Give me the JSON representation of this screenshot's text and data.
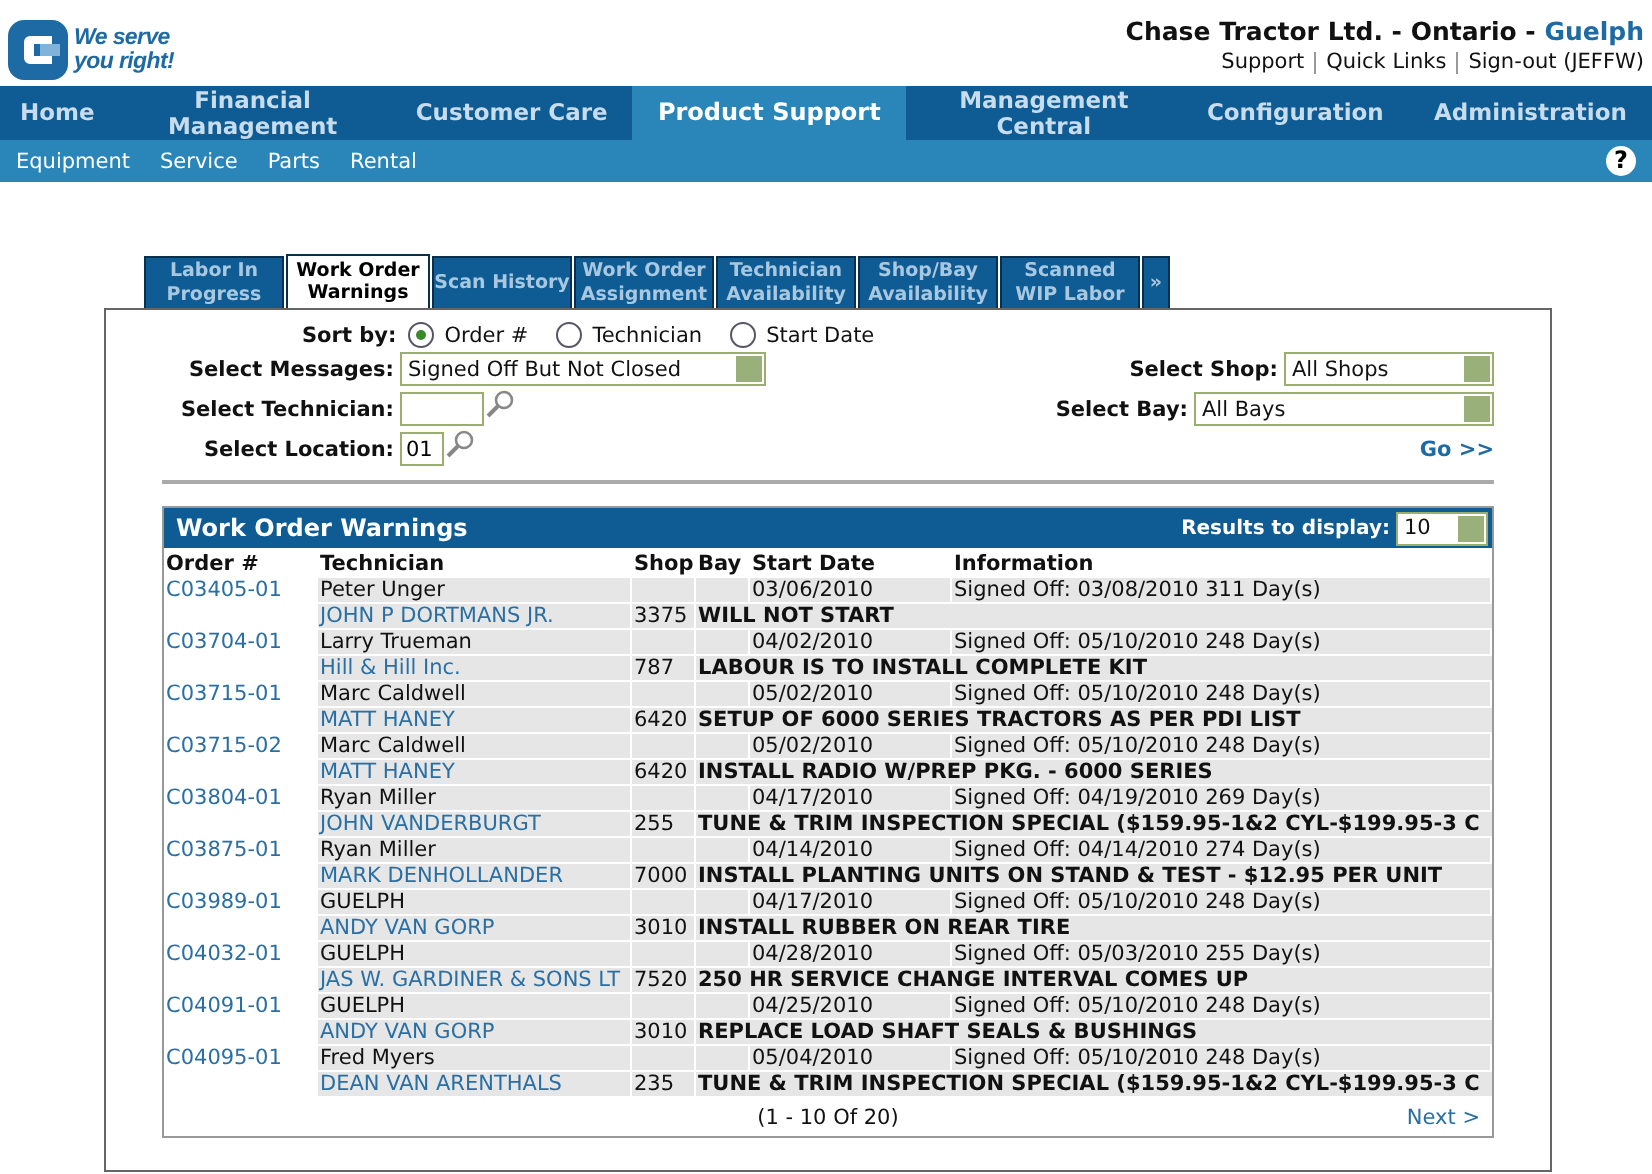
{
  "logo": {
    "tagline": "We serve you right!"
  },
  "header": {
    "company": "Chase Tractor Ltd. - Ontario - ",
    "location": "Guelph",
    "links": [
      "Support",
      "Quick Links",
      "Sign-out (JEFFW)"
    ]
  },
  "nav": [
    {
      "label": "Home",
      "selected": false
    },
    {
      "label": "Financial Management",
      "selected": false
    },
    {
      "label": "Customer Care",
      "selected": false
    },
    {
      "label": "Product Support",
      "selected": true
    },
    {
      "label": "Management Central",
      "selected": false
    },
    {
      "label": "Configuration",
      "selected": false
    },
    {
      "label": "Administration",
      "selected": false
    }
  ],
  "subnav": [
    "Equipment",
    "Service",
    "Parts",
    "Rental"
  ],
  "help_icon": "?",
  "tabs": [
    {
      "label": "Labor In Progress",
      "selected": false
    },
    {
      "label": "Work Order Warnings",
      "selected": true
    },
    {
      "label": "Scan History",
      "selected": false
    },
    {
      "label": "Work Order Assignment",
      "selected": false
    },
    {
      "label": "Technician Availability",
      "selected": false
    },
    {
      "label": "Shop/Bay Availability",
      "selected": false
    },
    {
      "label": "Scanned WIP Labor",
      "selected": false
    }
  ],
  "tabs_more": "»",
  "sort": {
    "label": "Sort by:",
    "options": [
      {
        "label": "Order #",
        "selected": true
      },
      {
        "label": "Technician",
        "selected": false
      },
      {
        "label": "Start Date",
        "selected": false
      }
    ]
  },
  "filters": {
    "messages_label": "Select Messages:",
    "messages_value": "Signed Off But Not Closed",
    "technician_label": "Select Technician:",
    "location_label": "Select Location:",
    "location_value": "01",
    "shop_label": "Select Shop:",
    "shop_value": "All Shops",
    "bay_label": "Select Bay:",
    "bay_value": "All Bays",
    "go": "Go >>"
  },
  "panel": {
    "title": "Work Order Warnings",
    "results_label": "Results to display:",
    "results_value": "10"
  },
  "table": {
    "columns": [
      "Order #",
      "Technician",
      "Shop",
      "Bay",
      "Start Date",
      "Information"
    ],
    "rows": [
      {
        "order": "C03405-01",
        "contact": "Peter Unger",
        "technician": "JOHN P DORTMANS JR.",
        "shop": "3375",
        "start_date": "03/06/2010",
        "information": "Signed Off: 03/08/2010 311 Day(s)",
        "description": "WILL NOT START"
      },
      {
        "order": "C03704-01",
        "contact": "Larry Trueman",
        "technician": "Hill & Hill Inc.",
        "shop": "787",
        "start_date": "04/02/2010",
        "information": "Signed Off: 05/10/2010 248 Day(s)",
        "description": "LABOUR IS TO INSTALL COMPLETE KIT"
      },
      {
        "order": "C03715-01",
        "contact": "Marc Caldwell",
        "technician": "MATT HANEY",
        "shop": "6420",
        "start_date": "05/02/2010",
        "information": "Signed Off: 05/10/2010 248 Day(s)",
        "description": "SETUP OF 6000 SERIES TRACTORS AS PER PDI LIST"
      },
      {
        "order": "C03715-02",
        "contact": "Marc Caldwell",
        "technician": "MATT HANEY",
        "shop": "6420",
        "start_date": "05/02/2010",
        "information": "Signed Off: 05/10/2010 248 Day(s)",
        "description": "INSTALL RADIO W/PREP PKG. - 6000 SERIES"
      },
      {
        "order": "C03804-01",
        "contact": "Ryan Miller",
        "technician": "JOHN VANDERBURGT",
        "shop": "255",
        "start_date": "04/17/2010",
        "information": "Signed Off: 04/19/2010 269 Day(s)",
        "description": "TUNE & TRIM INSPECTION SPECIAL ($159.95-1&2 CYL-$199.95-3 C"
      },
      {
        "order": "C03875-01",
        "contact": "Ryan Miller",
        "technician": "MARK DENHOLLANDER",
        "shop": "7000",
        "start_date": "04/14/2010",
        "information": "Signed Off: 04/14/2010 274 Day(s)",
        "description": "INSTALL PLANTING UNITS ON STAND & TEST - $12.95 PER UNIT"
      },
      {
        "order": "C03989-01",
        "contact": "GUELPH",
        "technician": "ANDY VAN GORP",
        "shop": "3010",
        "start_date": "04/17/2010",
        "information": "Signed Off: 05/10/2010 248 Day(s)",
        "description": "INSTALL RUBBER ON REAR TIRE"
      },
      {
        "order": "C04032-01",
        "contact": "GUELPH",
        "technician": "JAS W. GARDINER & SONS LT",
        "shop": "7520",
        "start_date": "04/28/2010",
        "information": "Signed Off: 05/03/2010 255 Day(s)",
        "description": "250 HR SERVICE CHANGE INTERVAL COMES UP"
      },
      {
        "order": "C04091-01",
        "contact": "GUELPH",
        "technician": "ANDY VAN GORP",
        "shop": "3010",
        "start_date": "04/25/2010",
        "information": "Signed Off: 05/10/2010 248 Day(s)",
        "description": "REPLACE LOAD SHAFT SEALS & BUSHINGS"
      },
      {
        "order": "C04095-01",
        "contact": "Fred Myers",
        "technician": "DEAN VAN ARENTHALS",
        "shop": "235",
        "start_date": "05/04/2010",
        "information": "Signed Off: 05/10/2010 248 Day(s)",
        "description": "TUNE & TRIM INSPECTION SPECIAL ($159.95-1&2 CYL-$199.95-3 C"
      }
    ]
  },
  "pager": {
    "range": "(1 - 10 Of 20)",
    "next": "Next >"
  }
}
